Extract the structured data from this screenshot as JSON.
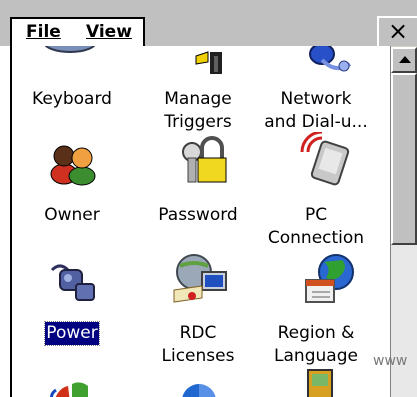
{
  "menubar": {
    "file_label": "File",
    "view_label": "View",
    "close_label": "×"
  },
  "items": [
    {
      "name": "Keyboard",
      "line1": "Keyboard",
      "line2": "",
      "icon": "keyboard-icon"
    },
    {
      "name": "Manage Triggers",
      "line1": "Manage",
      "line2": "Triggers",
      "icon": "manage-triggers-icon"
    },
    {
      "name": "Network and Dial-up",
      "line1": "Network",
      "line2": "and Dial-u...",
      "icon": "network-icon"
    },
    {
      "name": "Owner",
      "line1": "Owner",
      "line2": "",
      "icon": "owner-icon"
    },
    {
      "name": "Password",
      "line1": "Password",
      "line2": "",
      "icon": "password-icon"
    },
    {
      "name": "PC Connection",
      "line1": "PC",
      "line2": "Connection",
      "icon": "pc-connection-icon"
    },
    {
      "name": "Power",
      "line1": "Power",
      "line2": "",
      "icon": "power-icon",
      "selected": true
    },
    {
      "name": "RDC Licenses",
      "line1": "RDC",
      "line2": "Licenses",
      "icon": "rdc-licenses-icon"
    },
    {
      "name": "Region & Language",
      "line1": "Region &",
      "line2": "Language",
      "icon": "region-language-icon"
    }
  ],
  "watermark": "www"
}
